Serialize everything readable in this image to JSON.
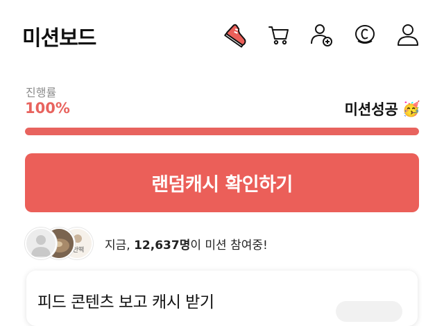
{
  "header": {
    "title": "미션보드",
    "icons": [
      "sneaker-icon",
      "cart-icon",
      "add-friend-icon",
      "coin-icon",
      "profile-icon"
    ]
  },
  "progress": {
    "label": "진행률",
    "value_text": "100%",
    "value": 100,
    "status": "미션성공",
    "status_emoji": "🥳"
  },
  "cta": {
    "label": "랜덤캐시 확인하기"
  },
  "participants": {
    "prefix": "지금, ",
    "count": "12,637명",
    "suffix": "이 미션 참여중!",
    "avatar_text": "안떡"
  },
  "feed_card": {
    "title": "피드 콘텐츠 보고 캐시 받기"
  },
  "colors": {
    "accent": "#eb5f59",
    "progress_text": "#e8635e",
    "track": "#f3d2d0"
  }
}
